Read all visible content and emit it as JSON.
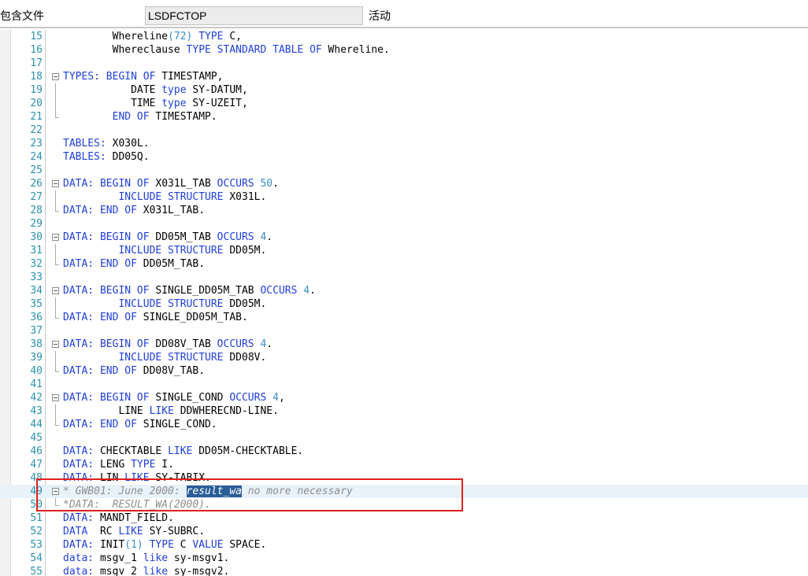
{
  "header": {
    "label": "包含文件",
    "program": "LSDFCTOP",
    "status": "活动"
  },
  "editor": {
    "lines": [
      {
        "num": "15",
        "fold": "",
        "segs": [
          [
            "t",
            "        Whereline"
          ],
          [
            "n",
            "(72)"
          ],
          [
            "t",
            " "
          ],
          [
            "k",
            "TYPE"
          ],
          [
            "t",
            " C,"
          ]
        ]
      },
      {
        "num": "16",
        "fold": "",
        "segs": [
          [
            "t",
            "        Whereclause "
          ],
          [
            "k",
            "TYPE STANDARD TABLE OF"
          ],
          [
            "t",
            " Whereline."
          ]
        ]
      },
      {
        "num": "17",
        "fold": "",
        "segs": []
      },
      {
        "num": "18",
        "fold": "box",
        "segs": [
          [
            "k",
            "TYPES: BEGIN OF"
          ],
          [
            "t",
            " TIMESTAMP,"
          ]
        ]
      },
      {
        "num": "19",
        "fold": "v",
        "segs": [
          [
            "t",
            "           DATE "
          ],
          [
            "k",
            "type"
          ],
          [
            "t",
            " SY-DATUM,"
          ]
        ]
      },
      {
        "num": "20",
        "fold": "v",
        "segs": [
          [
            "t",
            "           TIME "
          ],
          [
            "k",
            "type"
          ],
          [
            "t",
            " SY-UZEIT,"
          ]
        ]
      },
      {
        "num": "21",
        "fold": "end",
        "segs": [
          [
            "t",
            "        "
          ],
          [
            "k",
            "END OF"
          ],
          [
            "t",
            " TIMESTAMP."
          ]
        ]
      },
      {
        "num": "22",
        "fold": "",
        "segs": []
      },
      {
        "num": "23",
        "fold": "",
        "segs": [
          [
            "k",
            "TABLES:"
          ],
          [
            "t",
            " X030L."
          ]
        ]
      },
      {
        "num": "24",
        "fold": "",
        "segs": [
          [
            "k",
            "TABLES:"
          ],
          [
            "t",
            " DD05Q."
          ]
        ]
      },
      {
        "num": "25",
        "fold": "",
        "segs": []
      },
      {
        "num": "26",
        "fold": "box",
        "segs": [
          [
            "k",
            "DATA: BEGIN OF"
          ],
          [
            "t",
            " X031L_TAB "
          ],
          [
            "k",
            "OCCURS"
          ],
          [
            "t",
            " "
          ],
          [
            "n",
            "50"
          ],
          [
            "t",
            "."
          ]
        ]
      },
      {
        "num": "27",
        "fold": "v",
        "segs": [
          [
            "t",
            "         "
          ],
          [
            "k",
            "INCLUDE STRUCTURE"
          ],
          [
            "t",
            " X031L."
          ]
        ]
      },
      {
        "num": "28",
        "fold": "end",
        "segs": [
          [
            "k",
            "DATA: END OF"
          ],
          [
            "t",
            " X031L_TAB."
          ]
        ]
      },
      {
        "num": "29",
        "fold": "",
        "segs": []
      },
      {
        "num": "30",
        "fold": "box",
        "segs": [
          [
            "k",
            "DATA: BEGIN OF"
          ],
          [
            "t",
            " DD05M_TAB "
          ],
          [
            "k",
            "OCCURS"
          ],
          [
            "t",
            " "
          ],
          [
            "n",
            "4"
          ],
          [
            "t",
            "."
          ]
        ]
      },
      {
        "num": "31",
        "fold": "v",
        "segs": [
          [
            "t",
            "         "
          ],
          [
            "k",
            "INCLUDE STRUCTURE"
          ],
          [
            "t",
            " DD05M."
          ]
        ]
      },
      {
        "num": "32",
        "fold": "end",
        "segs": [
          [
            "k",
            "DATA: END OF"
          ],
          [
            "t",
            " DD05M_TAB."
          ]
        ]
      },
      {
        "num": "33",
        "fold": "",
        "segs": []
      },
      {
        "num": "34",
        "fold": "box",
        "segs": [
          [
            "k",
            "DATA: BEGIN OF"
          ],
          [
            "t",
            " SINGLE_DD05M_TAB "
          ],
          [
            "k",
            "OCCURS"
          ],
          [
            "t",
            " "
          ],
          [
            "n",
            "4"
          ],
          [
            "t",
            "."
          ]
        ]
      },
      {
        "num": "35",
        "fold": "v",
        "segs": [
          [
            "t",
            "         "
          ],
          [
            "k",
            "INCLUDE STRUCTURE"
          ],
          [
            "t",
            " DD05M."
          ]
        ]
      },
      {
        "num": "36",
        "fold": "end",
        "segs": [
          [
            "k",
            "DATA: END OF"
          ],
          [
            "t",
            " SINGLE_DD05M_TAB."
          ]
        ]
      },
      {
        "num": "37",
        "fold": "",
        "segs": []
      },
      {
        "num": "38",
        "fold": "box",
        "segs": [
          [
            "k",
            "DATA: BEGIN OF"
          ],
          [
            "t",
            " DD08V_TAB "
          ],
          [
            "k",
            "OCCURS"
          ],
          [
            "t",
            " "
          ],
          [
            "n",
            "4"
          ],
          [
            "t",
            "."
          ]
        ]
      },
      {
        "num": "39",
        "fold": "v",
        "segs": [
          [
            "t",
            "         "
          ],
          [
            "k",
            "INCLUDE STRUCTURE"
          ],
          [
            "t",
            " DD08V."
          ]
        ]
      },
      {
        "num": "40",
        "fold": "end",
        "segs": [
          [
            "k",
            "DATA: END OF"
          ],
          [
            "t",
            " DD08V_TAB."
          ]
        ]
      },
      {
        "num": "41",
        "fold": "",
        "segs": []
      },
      {
        "num": "42",
        "fold": "box",
        "segs": [
          [
            "k",
            "DATA: BEGIN OF"
          ],
          [
            "t",
            " SINGLE_COND "
          ],
          [
            "k",
            "OCCURS"
          ],
          [
            "t",
            " "
          ],
          [
            "n",
            "4"
          ],
          [
            "t",
            ","
          ]
        ]
      },
      {
        "num": "43",
        "fold": "v",
        "segs": [
          [
            "t",
            "         LINE "
          ],
          [
            "k",
            "LIKE"
          ],
          [
            "t",
            " DDWHERECND-LINE."
          ]
        ]
      },
      {
        "num": "44",
        "fold": "end",
        "segs": [
          [
            "k",
            "DATA: END OF"
          ],
          [
            "t",
            " SINGLE_COND."
          ]
        ]
      },
      {
        "num": "45",
        "fold": "",
        "segs": []
      },
      {
        "num": "46",
        "fold": "",
        "segs": [
          [
            "k",
            "DATA:"
          ],
          [
            "t",
            " CHECKTABLE "
          ],
          [
            "k",
            "LIKE"
          ],
          [
            "t",
            " DD05M-CHECKTABLE."
          ]
        ]
      },
      {
        "num": "47",
        "fold": "",
        "segs": [
          [
            "k",
            "DATA:"
          ],
          [
            "t",
            " LENG "
          ],
          [
            "k",
            "TYPE"
          ],
          [
            "t",
            " I."
          ]
        ]
      },
      {
        "num": "48",
        "fold": "",
        "segs": [
          [
            "k",
            "DATA:"
          ],
          [
            "t",
            " LIN "
          ],
          [
            "k",
            "LIKE"
          ],
          [
            "t",
            " SY-TABIX."
          ]
        ]
      },
      {
        "num": "49",
        "fold": "box",
        "cur": true,
        "segs": [
          [
            "c",
            "* GWB01: June 2000: "
          ],
          [
            "h",
            "result_wa"
          ],
          [
            "c",
            " no more necessary"
          ]
        ]
      },
      {
        "num": "50",
        "fold": "end",
        "segs": [
          [
            "c",
            "*DATA:  RESULT_WA(2000)."
          ]
        ]
      },
      {
        "num": "51",
        "fold": "",
        "segs": [
          [
            "k",
            "DATA:"
          ],
          [
            "t",
            " MANDT_FIELD."
          ]
        ]
      },
      {
        "num": "52",
        "fold": "",
        "segs": [
          [
            "k",
            "DATA"
          ],
          [
            "t",
            "  RC "
          ],
          [
            "k",
            "LIKE"
          ],
          [
            "t",
            " SY-SUBRC."
          ]
        ]
      },
      {
        "num": "53",
        "fold": "",
        "segs": [
          [
            "k",
            "DATA:"
          ],
          [
            "t",
            " INIT"
          ],
          [
            "n",
            "(1)"
          ],
          [
            "t",
            " "
          ],
          [
            "k",
            "TYPE"
          ],
          [
            "t",
            " C "
          ],
          [
            "k",
            "VALUE"
          ],
          [
            "t",
            " SPACE."
          ]
        ]
      },
      {
        "num": "54",
        "fold": "",
        "segs": [
          [
            "k",
            "data:"
          ],
          [
            "t",
            " msgv_1 "
          ],
          [
            "k",
            "like"
          ],
          [
            "t",
            " sy-msgv1."
          ]
        ]
      },
      {
        "num": "55",
        "fold": "",
        "segs": [
          [
            "k",
            "data:"
          ],
          [
            "t",
            " msgv_2 "
          ],
          [
            "k",
            "like"
          ],
          [
            "t",
            " sy-msgv2."
          ]
        ]
      }
    ]
  }
}
